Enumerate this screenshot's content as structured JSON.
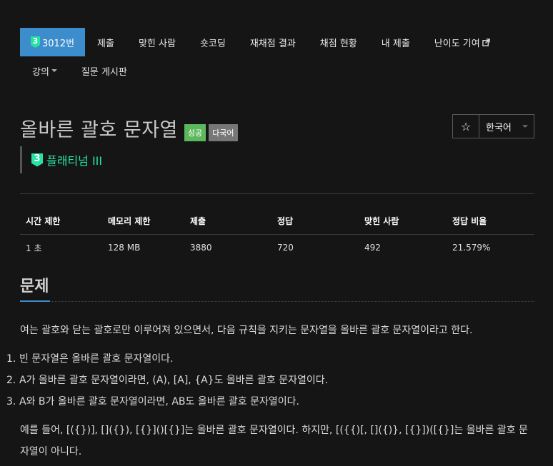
{
  "nav": {
    "tier_badge": "3",
    "problem_id": "3012번",
    "items": [
      "제출",
      "맞힌 사람",
      "숏코딩",
      "재채점 결과",
      "채점 현황",
      "내 제출",
      "난이도 기여"
    ],
    "row2": [
      "강의",
      "질문 게시판"
    ]
  },
  "header": {
    "title": "올바른 괄호 문자열",
    "label_success": "성공",
    "label_multilang": "다국어",
    "star": "☆",
    "language": "한국어"
  },
  "tier": {
    "badge": "3",
    "name": "플래티넘 III",
    "color": "#27e2a4"
  },
  "info": {
    "headers": [
      "시간 제한",
      "메모리 제한",
      "제출",
      "정답",
      "맞힌 사람",
      "정답 비율"
    ],
    "values": [
      "1 초",
      "128 MB",
      "3880",
      "720",
      "492",
      "21.579%"
    ]
  },
  "section": {
    "title": "문제",
    "intro": "여는 괄호와 닫는 괄호로만 이루어져 있으면서, 다음 규칙을 지키는 문자열을 올바른 괄호 문자열이라고 한다.",
    "rules": [
      {
        "num": "1.",
        "text": "빈 문자열은 올바른 괄호 문자열이다."
      },
      {
        "num": "2.",
        "text": "A가 올바른 괄호 문자열이라면, (A), [A], {A}도 올바른 괄호 문자열이다."
      },
      {
        "num": "3.",
        "text": "A와 B가 올바른 괄호 문자열이라면, AB도 올바른 괄호 문자열이다."
      }
    ],
    "example": "예를 들어, [({})], []({}), [{}]()[{}]는 올바른 괄호 문자열이다. 하지만, [({{)[, []({)}, [{}])([{}]는 올바른 괄호 문자열이 아니다."
  },
  "colors": {
    "accent": "#3c8dcc",
    "success": "#5cb85c",
    "background": "#151515"
  }
}
